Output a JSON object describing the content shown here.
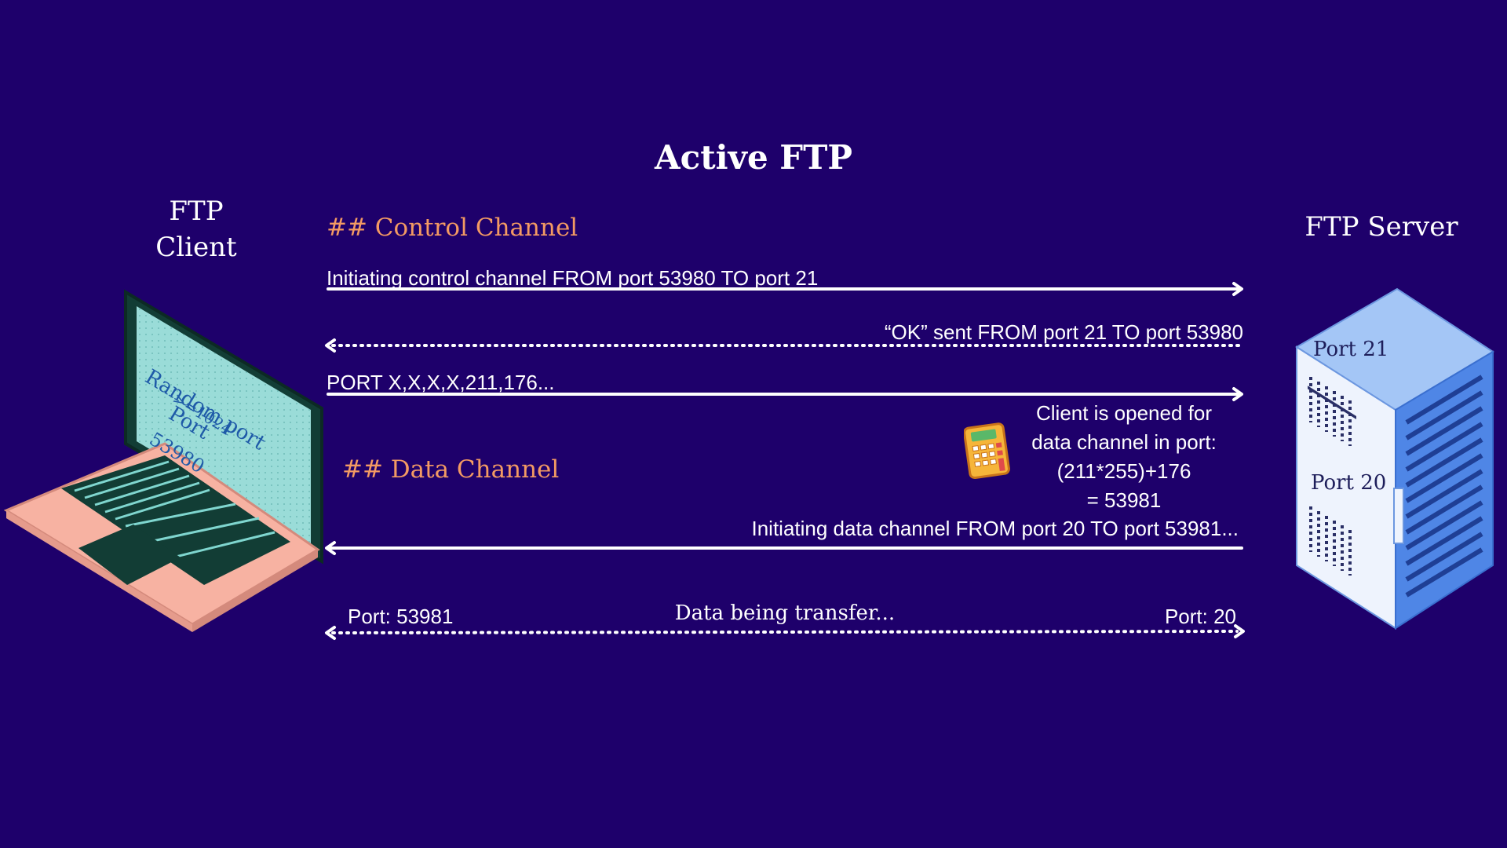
{
  "title": "Active FTP",
  "client": {
    "label_line1": "FTP",
    "label_line2": "Client",
    "screen": {
      "line1": "Random port",
      "line2": ">=1024",
      "line3": "Port",
      "line4": "53980"
    }
  },
  "server": {
    "label": "FTP Server",
    "port_top": "Port 21",
    "port_bottom": "Port 20"
  },
  "sections": {
    "control": "## Control Channel",
    "data": "## Data Channel"
  },
  "messages": {
    "m1": "Initiating control channel FROM port 53980 TO port 21",
    "m2": "“OK” sent FROM port 21 TO port 53980",
    "m3": "PORT X,X,X,X,211,176...",
    "m4": "Initiating data channel FROM port 20 TO port 53981...",
    "m5_left": "Port: 53981",
    "m5_center": "Data being transfer...",
    "m5_right": "Port: 20"
  },
  "calc_note": {
    "line1": "Client is opened for",
    "line2": "data channel in port:",
    "line3": "(211*255)+176",
    "line4": "= 53981"
  },
  "colors": {
    "background": "#1e006b",
    "section": "#f39a63",
    "arrow": "#ffffff",
    "laptop_screen": "#9adcd8",
    "laptop_body": "#f7b2a2",
    "server": "#4f86e6"
  },
  "icons": [
    "laptop-icon",
    "server-icon",
    "calculator-icon"
  ]
}
